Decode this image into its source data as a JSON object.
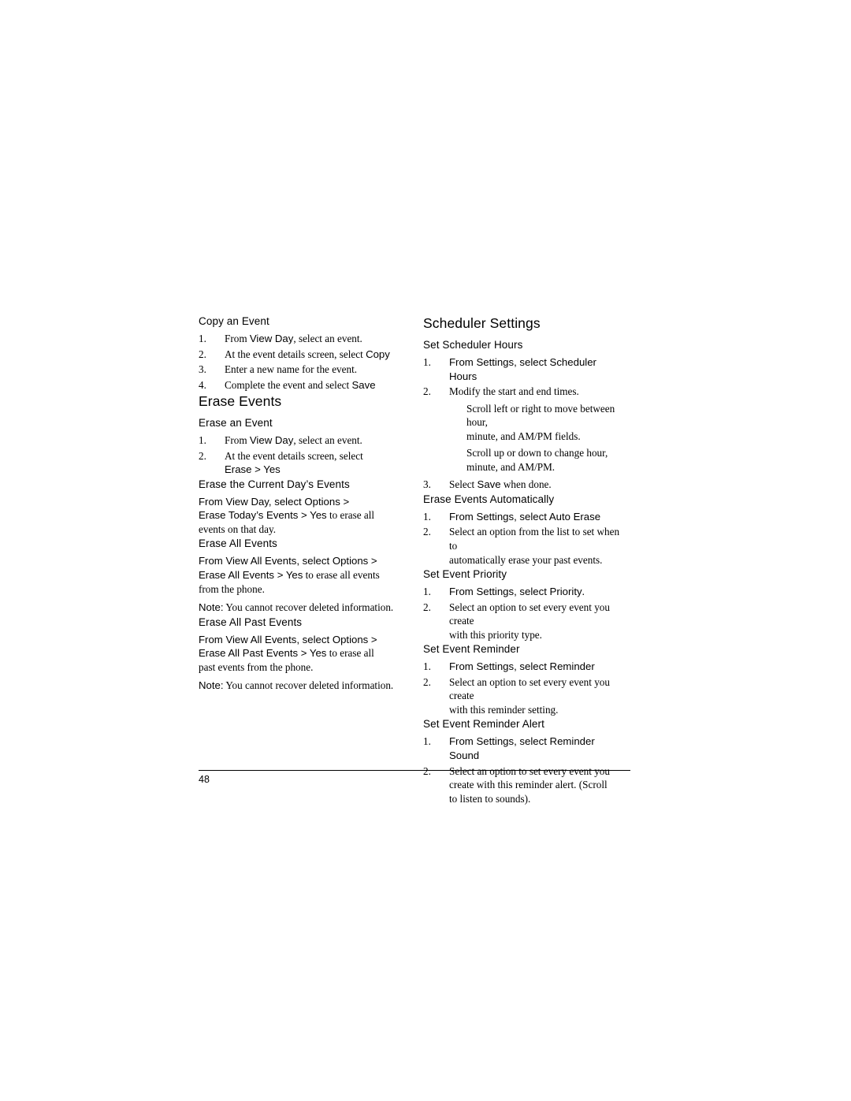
{
  "page": {
    "number": "48"
  },
  "left_column": {
    "copy_event": {
      "heading": "Copy an Event",
      "steps": [
        {
          "num": "1.",
          "text_before": "From ",
          "bold1": "View Day",
          "text_mid": ", select an event.",
          "full": "From View Day, select an event."
        },
        {
          "num": "2.",
          "full": "At the event details screen, select ",
          "bold1": "Copy"
        },
        {
          "num": "3.",
          "full": "Enter a new name for the event."
        },
        {
          "num": "4.",
          "full": "Complete the event and select ",
          "bold1": "Save"
        }
      ]
    },
    "erase_events": {
      "heading": "Erase Events"
    },
    "erase_an_event": {
      "heading": "Erase an Event",
      "steps": [
        {
          "num": "1.",
          "full": "From ",
          "bold1": "View Day",
          "after": ", select an event."
        },
        {
          "num": "2.",
          "full": "At the event details screen, select",
          "line2_bold": "Erase",
          "line2_mid": " > ",
          "line2_bold2": "Yes"
        }
      ]
    },
    "erase_current_day": {
      "heading": "Erase the Current Day’s Events",
      "line1_a": "From ",
      "line1_b": "View Day",
      "line1_c": ", select ",
      "line1_d": "Options",
      "line1_e": " > ",
      "line2_a": "Erase Today’s Events",
      "line2_b": " > ",
      "line2_c": "Yes",
      "line2_d": " to erase all",
      "line3": "events on that day."
    },
    "erase_all_events": {
      "heading": "Erase All Events",
      "line1_a": "From ",
      "line1_b": "View All Events",
      "line1_c": ", select ",
      "line1_d": "Options",
      "line1_e": " > ",
      "line2_a": "Erase All Events",
      "line2_b": " > ",
      "line2_c": "Yes",
      "line2_d": " to erase all events",
      "line3": "from the phone.",
      "note_label": "Note:",
      "note_text": " You cannot recover deleted information."
    },
    "erase_all_past_events": {
      "heading": "Erase All Past Events",
      "line1_a": "From ",
      "line1_b": "View All Events",
      "line1_c": ", select ",
      "line1_d": "Options",
      "line1_e": " > ",
      "line2_a": "Erase All Past Events",
      "line2_b": " > ",
      "line2_c": "Yes",
      "line2_d": " to erase all",
      "line3": "past events from the phone.",
      "note_label": "Note:",
      "note_text": " You cannot recover deleted information."
    }
  },
  "right_column": {
    "scheduler_settings": {
      "heading": "Scheduler Settings"
    },
    "set_scheduler_hours": {
      "heading": "Set Scheduler Hours",
      "step1_num": "1.",
      "step1_a": "From ",
      "step1_b": "Settings",
      "step1_c": ", select ",
      "step1_d": "Scheduler Hours",
      "step2_num": "2.",
      "step2_text": "Modify the start and end times.",
      "sub1_line1": "Scroll left or right to move between hour,",
      "sub1_line2": "minute, and AM/PM fields.",
      "sub2_line1": "Scroll up or down to change hour,",
      "sub2_line2": "minute, and AM/PM.",
      "step3_num": "3.",
      "step3_a": "Select ",
      "step3_b": "Save",
      "step3_c": " when done."
    },
    "erase_events_automatically": {
      "heading": "Erase Events Automatically",
      "step1_num": "1.",
      "step1_a": "From ",
      "step1_b": "Settings",
      "step1_c": ", select ",
      "step1_d": "Auto Erase",
      "step2_num": "2.",
      "step2_line1": "Select an option from the list to set when to",
      "step2_line2": "automatically erase your past events."
    },
    "set_event_priority": {
      "heading": "Set Event Priority",
      "step1_num": "1.",
      "step1_a": "From ",
      "step1_b": "Settings",
      "step1_c": ", select ",
      "step1_d": "Priority",
      "step1_e": ".",
      "step2_num": "2.",
      "step2_line1": "Select an option to set every event you create",
      "step2_line2": "with this priority type."
    },
    "set_event_reminder": {
      "heading": "Set Event Reminder",
      "step1_num": "1.",
      "step1_a": "From ",
      "step1_b": "Settings",
      "step1_c": ", select ",
      "step1_d": "Reminder",
      "step2_num": "2.",
      "step2_line1": "Select an option to set every event you create",
      "step2_line2": "with this reminder setting."
    },
    "set_event_reminder_alert": {
      "heading": "Set Event Reminder Alert",
      "step1_num": "1.",
      "step1_a": "From ",
      "step1_b": "Settings",
      "step1_c": ", select ",
      "step1_d": "Reminder Sound",
      "step2_num": "2.",
      "step2_line1": "Select an option to set every event you",
      "step2_line2": "create with this reminder alert. (Scroll",
      "step2_line3": "to listen to sounds)."
    }
  }
}
